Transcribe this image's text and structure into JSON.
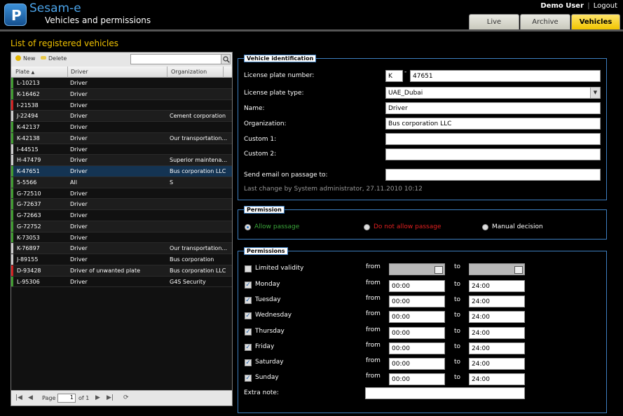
{
  "header": {
    "logo_letter": "P",
    "app_name": "Sesam-e",
    "subtitle": "Vehicles and permissions",
    "user_name": "Demo User",
    "separator": "|",
    "logout": "Logout",
    "tabs": [
      {
        "label": "Live"
      },
      {
        "label": "Archive"
      },
      {
        "label": "Vehicles"
      }
    ]
  },
  "list": {
    "title": "List of registered vehicles",
    "new_label": "New",
    "delete_label": "Delete",
    "search_value": "",
    "columns": {
      "plate": "Plate",
      "driver": "Driver",
      "organization": "Organization"
    },
    "rows": [
      {
        "plate": "L-10213",
        "driver": "Driver",
        "organization": "",
        "mark": "#3e9a2e"
      },
      {
        "plate": "K-16462",
        "driver": "Driver",
        "organization": "",
        "mark": "#3e9a2e"
      },
      {
        "plate": "I-21538",
        "driver": "Driver",
        "organization": "",
        "mark": "#d02020"
      },
      {
        "plate": "J-22494",
        "driver": "Driver",
        "organization": "Cement corporation",
        "mark": "#cccccc"
      },
      {
        "plate": "K-42137",
        "driver": "Driver",
        "organization": "",
        "mark": "#3e9a2e"
      },
      {
        "plate": "K-42138",
        "driver": "Driver",
        "organization": "Our transportation...",
        "mark": "#3e9a2e"
      },
      {
        "plate": "I-44515",
        "driver": "Driver",
        "organization": "",
        "mark": "#cccccc"
      },
      {
        "plate": "H-47479",
        "driver": "Driver",
        "organization": "Superior maintena...",
        "mark": "#cccccc"
      },
      {
        "plate": "K-47651",
        "driver": "Driver",
        "organization": "Bus corporation LLC",
        "mark": "#3e9a2e"
      },
      {
        "plate": "5-5566",
        "driver": "All",
        "organization": "S",
        "mark": "#3e9a2e"
      },
      {
        "plate": "G-72510",
        "driver": "Driver",
        "organization": "",
        "mark": "#3e9a2e"
      },
      {
        "plate": "G-72637",
        "driver": "Driver",
        "organization": "",
        "mark": "#3e9a2e"
      },
      {
        "plate": "G-72663",
        "driver": "Driver",
        "organization": "",
        "mark": "#3e9a2e"
      },
      {
        "plate": "G-72752",
        "driver": "Driver",
        "organization": "",
        "mark": "#3e9a2e"
      },
      {
        "plate": "K-73053",
        "driver": "Driver",
        "organization": "",
        "mark": "#3e9a2e"
      },
      {
        "plate": "K-76897",
        "driver": "Driver",
        "organization": "Our transportation...",
        "mark": "#cccccc"
      },
      {
        "plate": "J-89155",
        "driver": "Driver",
        "organization": "Bus corporation",
        "mark": "#cccccc"
      },
      {
        "plate": "D-93428",
        "driver": "Driver of unwanted plate",
        "organization": "Bus corporation LLC",
        "mark": "#d02020"
      },
      {
        "plate": "L-95306",
        "driver": "Driver",
        "organization": "G4S Security",
        "mark": "#3e9a2e"
      }
    ],
    "selected_plate": "K-47651",
    "pager": {
      "page_label": "Page",
      "page_value": "1",
      "of_label": "of 1"
    }
  },
  "identification": {
    "legend": "Vehicle identification",
    "license_plate_label": "License plate number:",
    "plate_prefix": "K",
    "plate_dash": "-",
    "plate_number": "47651",
    "plate_type_label": "License plate type:",
    "plate_type_value": "UAE_Dubai",
    "name_label": "Name:",
    "name_value": "Driver",
    "organization_label": "Organization:",
    "organization_value": "Bus corporation LLC",
    "custom1_label": "Custom 1:",
    "custom1_value": "",
    "custom2_label": "Custom 2:",
    "custom2_value": "",
    "email_label": "Send email on passage to:",
    "email_value": "",
    "last_change": "Last change by System administrator, 27.11.2010 10:12"
  },
  "permission": {
    "legend": "Permission",
    "options": [
      {
        "label": "Allow passage",
        "color": "#3aa53a",
        "selected": true
      },
      {
        "label": "Do not allow passage",
        "color": "#e02020",
        "selected": false
      },
      {
        "label": "Manual decision",
        "color": "#ffffff",
        "selected": false
      }
    ]
  },
  "permissions": {
    "legend": "Permissions",
    "from_label": "from",
    "to_label": "to",
    "limited_validity_label": "Limited validity",
    "days": [
      {
        "label": "Monday",
        "from": "00:00",
        "to": "24:00",
        "checked": true
      },
      {
        "label": "Tuesday",
        "from": "00:00",
        "to": "24:00",
        "checked": true
      },
      {
        "label": "Wednesday",
        "from": "00:00",
        "to": "24:00",
        "checked": true
      },
      {
        "label": "Thursday",
        "from": "00:00",
        "to": "24:00",
        "checked": true
      },
      {
        "label": "Friday",
        "from": "00:00",
        "to": "24:00",
        "checked": true
      },
      {
        "label": "Saturday",
        "from": "00:00",
        "to": "24:00",
        "checked": true
      },
      {
        "label": "Sunday",
        "from": "00:00",
        "to": "24:00",
        "checked": true
      }
    ],
    "extra_note_label": "Extra note:",
    "extra_note_value": ""
  }
}
